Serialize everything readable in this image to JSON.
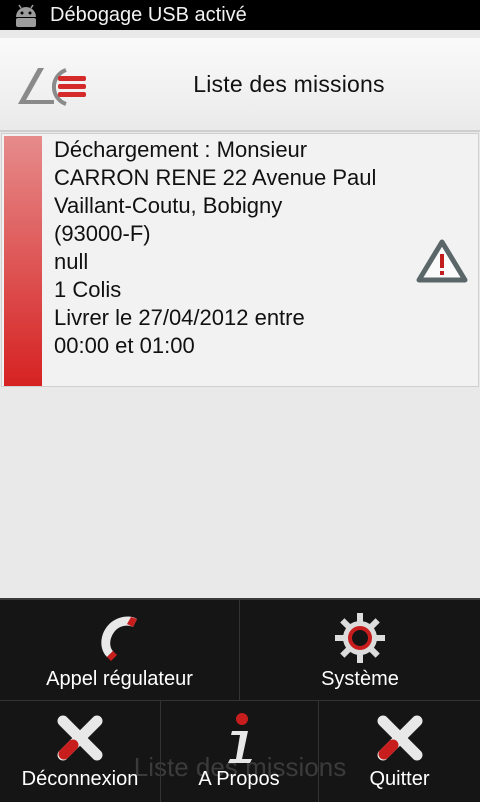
{
  "status_bar": {
    "text": "Débogage USB activé",
    "icon": "android-icon"
  },
  "header": {
    "title": "Liste des missions",
    "logo": "lc-logo-icon"
  },
  "mission": {
    "lines": [
      "Déchargement : Monsieur",
      "CARRON RENE 22 Avenue Paul",
      "Vaillant-Coutu, Bobigny",
      "(93000-F)",
      "null",
      "1 Colis",
      "Livrer le 27/04/2012 entre",
      "00:00 et 01:00"
    ],
    "status_icon": "warning-icon",
    "strip_color": "#d62222"
  },
  "menu": {
    "items": [
      {
        "label": "Appel régulateur",
        "icon": "phone-icon"
      },
      {
        "label": "Système",
        "icon": "gear-icon"
      },
      {
        "label": "Déconnexion",
        "icon": "close-icon"
      },
      {
        "label": "A Propos",
        "icon": "info-icon"
      },
      {
        "label": "Quitter",
        "icon": "close-icon"
      }
    ],
    "background_title": "Liste des missions"
  },
  "colors": {
    "accent": "#d62222",
    "menu_bg": "#151515",
    "header_bg": "#f2f2f2"
  }
}
